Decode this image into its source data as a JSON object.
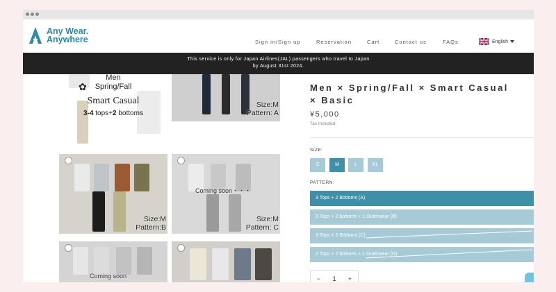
{
  "brand": {
    "line1": "Any Wear.",
    "line2": "Anywhere",
    "color": "#2a8aa8"
  },
  "nav": {
    "items": [
      "Sign in/Sign up",
      "Reservation",
      "Cart",
      "Contact us",
      "FAQs"
    ],
    "language": "English"
  },
  "banner": {
    "line1": "This service is only for Japan Airlines(JAL) passengers who travel to Japan",
    "line2": "by August 31st 2024."
  },
  "gallery": {
    "hero": {
      "line1": "Men",
      "line2": "Spring/Fall",
      "line3": "Smart Casual",
      "line4_pre": "3-4",
      "line4_mid": " tops+",
      "line4_num": "2",
      "line4_post": " bottoms"
    },
    "photo_a": {
      "size": "Size:M",
      "pattern": "Pattern: A"
    },
    "photo_b": {
      "size": "Size:M",
      "pattern": "Pattern:B"
    },
    "photo_c": {
      "soon": "Coming soon・・・",
      "size": "Size:M",
      "pattern": "Pattern: C"
    },
    "photo_d": {
      "soon": "Coming soon"
    }
  },
  "product": {
    "title": "Men × Spring/Fall × Smart Casual × Basic",
    "price": "¥5,000",
    "tax": "Tax included.",
    "size_label": "SIZE:",
    "sizes": [
      "S",
      "M",
      "L",
      "XL"
    ],
    "selected_size": "M",
    "pattern_label": "PATTERN:",
    "patterns": [
      "3 Tops + 2 Bottoms (A)",
      "3 Tops + 2 bottoms + 1 Outerwear (B)",
      "3 Tops + 2 Bottoms (C)",
      "3 Tops + 2 bottoms + 1 Outerwear (D)"
    ],
    "selected_pattern": "3 Tops + 2 Bottoms (A)",
    "quantity": {
      "minus": "−",
      "value": "1",
      "plus": "+"
    }
  },
  "colors": {
    "accent": "#3e8fa7",
    "swatch": "#a6cbd6",
    "banner": "#222222",
    "background": "#fbeeee"
  },
  "icons": [
    "logo-a-icon",
    "uk-flag-icon",
    "caret-down-icon",
    "chat-icon"
  ]
}
